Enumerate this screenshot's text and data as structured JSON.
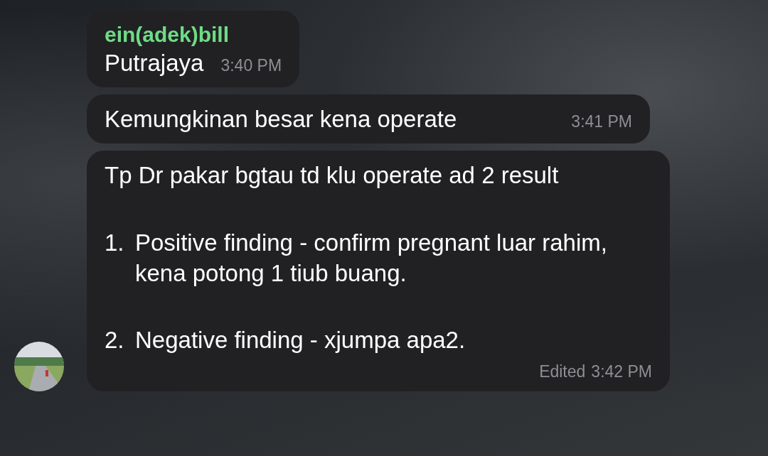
{
  "messages": [
    {
      "sender": "ein(adek)bill",
      "paragraphs": [
        {
          "kind": "text",
          "text": "Putrajaya"
        }
      ],
      "time": "3:40 PM"
    },
    {
      "paragraphs": [
        {
          "kind": "text",
          "text": "Kemungkinan besar kena operate"
        }
      ],
      "time": "3:41 PM"
    },
    {
      "paragraphs": [
        {
          "kind": "text",
          "text": "Tp Dr pakar bgtau td klu operate ad 2 result"
        },
        {
          "kind": "list_item",
          "number": "1.",
          "text": "Positive finding - confirm pregnant luar rahim, kena potong 1 tiub buang."
        },
        {
          "kind": "list_item",
          "number": "2.",
          "text": "Negative finding - xjumpa apa2."
        }
      ],
      "edited_label": "Edited",
      "time": "3:42 PM"
    }
  ]
}
